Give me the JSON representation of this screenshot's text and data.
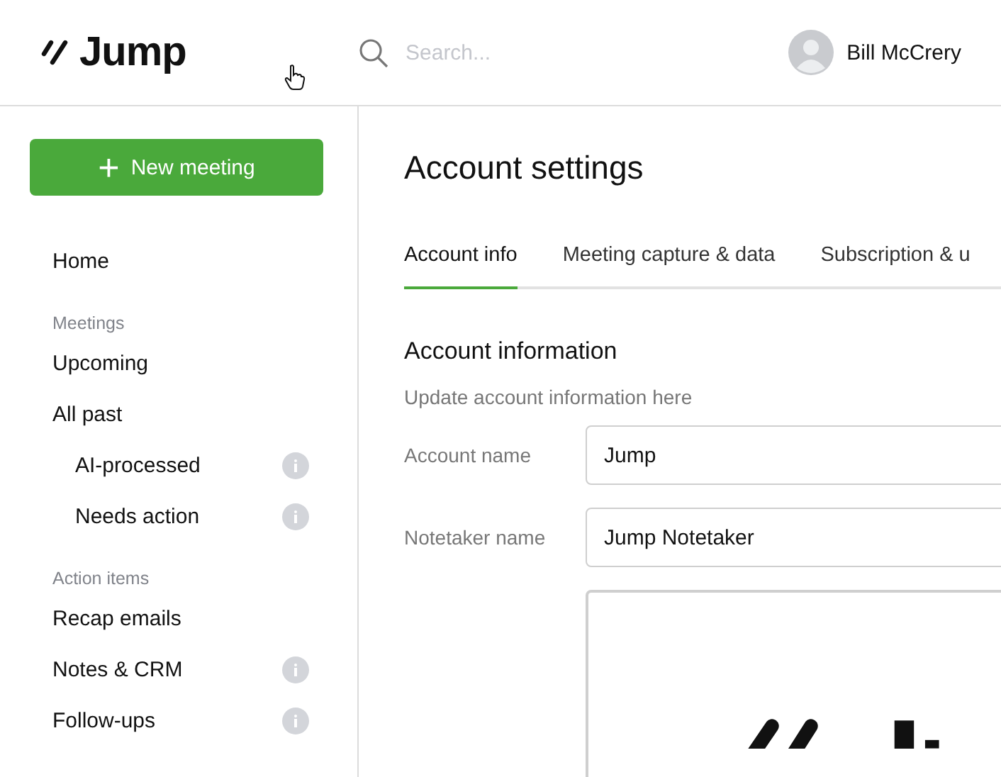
{
  "header": {
    "brand": "Jump",
    "search": {
      "placeholder": "Search..."
    },
    "user": {
      "name": "Bill McCrery"
    }
  },
  "sidebar": {
    "new_button": {
      "icon": "+",
      "label": "New meeting"
    },
    "items": [
      {
        "kind": "link",
        "label": "Home"
      },
      {
        "kind": "section",
        "label": "Meetings"
      },
      {
        "kind": "link",
        "label": "Upcoming"
      },
      {
        "kind": "link",
        "label": "All past",
        "children": [
          {
            "label": "AI-processed",
            "info": true
          },
          {
            "label": "Needs action",
            "info": true
          }
        ]
      },
      {
        "kind": "section",
        "label": "Action items"
      },
      {
        "kind": "link",
        "label": "Recap emails"
      },
      {
        "kind": "link",
        "label": "Notes & CRM",
        "info": true
      },
      {
        "kind": "link",
        "label": "Follow-ups",
        "info": true
      }
    ]
  },
  "main": {
    "title": "Account settings",
    "tabs": [
      {
        "label": "Account info",
        "selected": true
      },
      {
        "label": "Meeting capture & data",
        "selected": false
      },
      {
        "label": "Subscription & u",
        "selected": false
      }
    ],
    "section": {
      "title": "Account information",
      "subtitle": "Update account information here",
      "fields": [
        {
          "kind": "text",
          "label": "Account name",
          "value": "Jump"
        },
        {
          "kind": "text",
          "label": "Notetaker name",
          "value": "Jump Notetaker"
        },
        {
          "kind": "image"
        }
      ]
    }
  }
}
